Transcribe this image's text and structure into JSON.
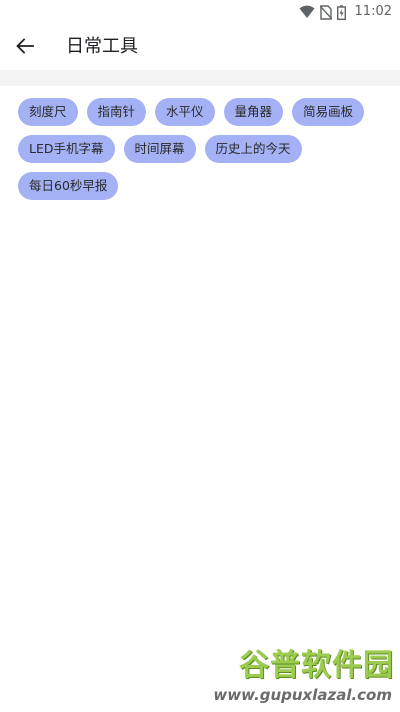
{
  "status_bar": {
    "time": "11:02",
    "icons": [
      "wifi-icon",
      "no-sim-icon",
      "battery-charging-icon"
    ]
  },
  "app_bar": {
    "back_icon": "arrow-left-icon",
    "title": "日常工具"
  },
  "tools": [
    {
      "label": "刻度尺"
    },
    {
      "label": "指南针"
    },
    {
      "label": "水平仪"
    },
    {
      "label": "量角器"
    },
    {
      "label": "简易画板"
    },
    {
      "label": "LED手机字幕"
    },
    {
      "label": "时间屏幕"
    },
    {
      "label": "历史上的今天"
    },
    {
      "label": "每日60秒早报"
    }
  ],
  "colors": {
    "chip_background": "#a4b1f5",
    "divider_band": "#f3f3f3",
    "watermark_green": "#9ccc4f"
  },
  "watermark": {
    "brand": "谷普软件园",
    "url": "www.gupuxlazal.com"
  }
}
